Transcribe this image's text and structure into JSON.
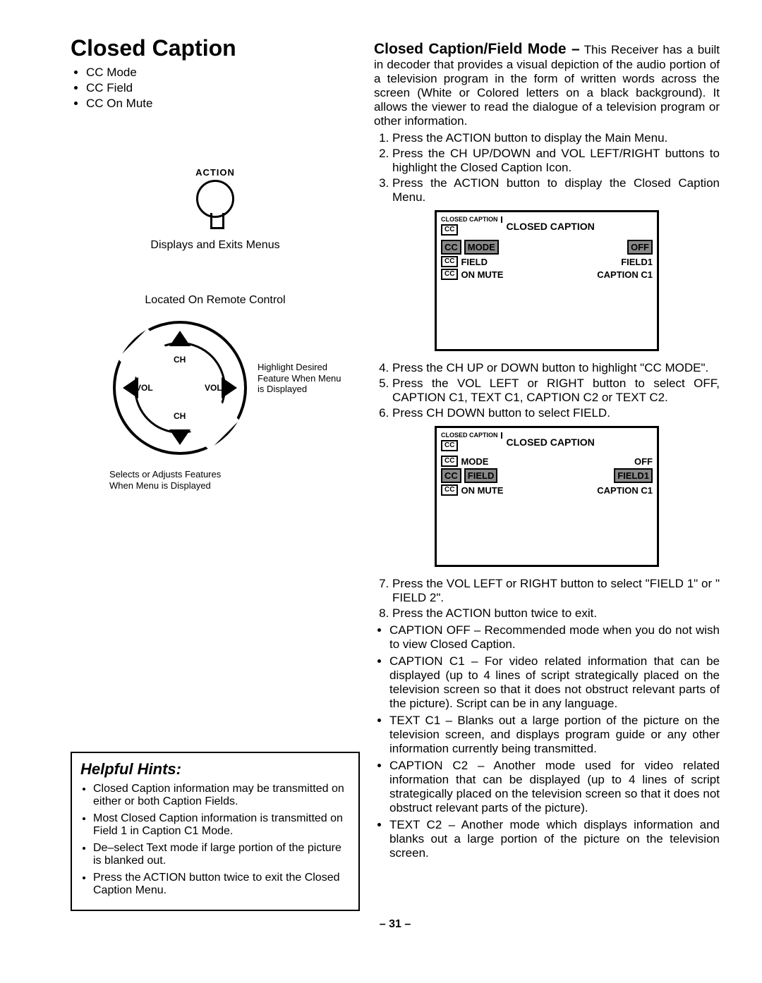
{
  "title": "Closed Caption",
  "toc": [
    "CC Mode",
    "CC Field",
    "CC On Mute"
  ],
  "action": {
    "label": "ACTION",
    "desc": "Displays and Exits Menus"
  },
  "remote": {
    "located": "Located On Remote Control",
    "ch": "CH",
    "vol": "VOL",
    "note_right": "Highlight Desired Feature When Menu is Displayed",
    "note_below": "Selects or Adjusts Features When Menu is Displayed"
  },
  "hints": {
    "title": "Helpful Hints:",
    "items": [
      "Closed Caption information may be transmitted on either or both Caption Fields.",
      "Most Closed Caption information is transmitted on Field 1 in Caption C1 Mode.",
      "De–select Text mode if large portion of the picture is blanked out.",
      "Press the ACTION button twice to exit the Closed Caption Menu."
    ]
  },
  "right": {
    "heading_prefix": "Closed Caption/Field Mode –",
    "intro": "This Receiver has a built in decoder that provides a visual depiction of the audio portion of a television program in the form of written words across the screen (White or Colored letters on a black background). It allows the viewer to read the dialogue of a television program or other information.",
    "steps_a": [
      "Press the ACTION button to display the Main Menu.",
      "Press the CH UP/DOWN and VOL LEFT/RIGHT buttons to highlight the Closed Caption Icon.",
      "Press the ACTION button to display the Closed Caption Menu."
    ],
    "steps_b": [
      "Press the CH UP or DOWN button to highlight \"CC MODE\".",
      "Press the VOL LEFT or RIGHT button to select OFF, CAPTION C1, TEXT C1, CAPTION C2 or TEXT C2.",
      "Press CH DOWN button to select FIELD."
    ],
    "steps_c": [
      "Press the VOL LEFT or RIGHT button to select \"FIELD 1\" or \" FIELD 2\".",
      "Press the ACTION button twice to exit."
    ],
    "bullets": [
      "CAPTION OFF – Recommended mode when you do not wish to view Closed Caption.",
      "CAPTION C1 – For video related information that can be displayed (up to 4 lines of script strategically placed on the television screen so that it does not obstruct relevant parts of the picture). Script can be in any language.",
      "TEXT C1 – Blanks out a large portion of the picture on the television screen, and displays program guide or any other information currently being transmitted.",
      "CAPTION C2 – Another mode used for video related information that can be displayed (up to 4 lines of script strategically placed on the television screen so that it does not obstruct relevant parts of the picture).",
      "TEXT C2 – Another mode which displays information and blanks out a large portion of the picture on the television screen."
    ],
    "osd": {
      "cc_small": "CLOSED CAPTION",
      "cc_big": "CLOSED CAPTION",
      "cc_icon": "CC",
      "rows": {
        "mode": "MODE",
        "field": "FIELD",
        "on_mute": "ON MUTE",
        "off": "OFF",
        "field1": "FIELD1",
        "c1": "CAPTION C1"
      }
    }
  },
  "page_num": "– 31 –"
}
